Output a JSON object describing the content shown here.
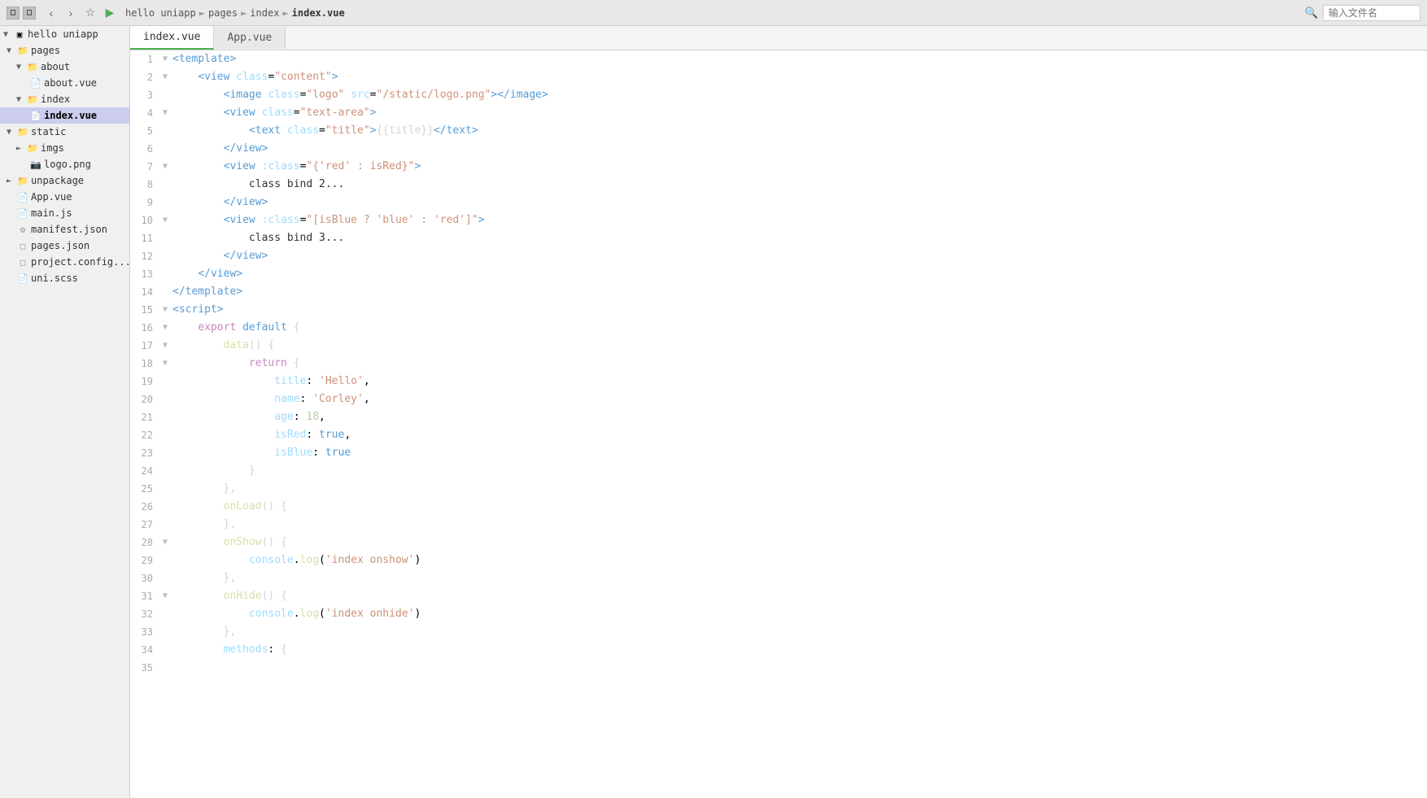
{
  "titleBar": {
    "breadcrumbs": [
      "hello uniapp",
      "pages",
      "index",
      "index.vue"
    ],
    "searchPlaceholder": "输入文件名"
  },
  "tabs": [
    {
      "label": "index.vue",
      "active": true
    },
    {
      "label": "App.vue",
      "active": false
    }
  ],
  "sidebar": {
    "root": "hello uniapp",
    "items": [
      {
        "level": 0,
        "type": "folder",
        "label": "pages",
        "expanded": true,
        "selected": false
      },
      {
        "level": 1,
        "type": "folder",
        "label": "about",
        "expanded": true,
        "selected": false
      },
      {
        "level": 2,
        "type": "file",
        "label": "about.vue",
        "selected": false
      },
      {
        "level": 1,
        "type": "folder",
        "label": "index",
        "expanded": true,
        "selected": false
      },
      {
        "level": 2,
        "type": "file",
        "label": "index.vue",
        "selected": true
      },
      {
        "level": 0,
        "type": "folder",
        "label": "static",
        "expanded": true,
        "selected": false
      },
      {
        "level": 1,
        "type": "folder",
        "label": "imgs",
        "expanded": false,
        "selected": false
      },
      {
        "level": 1,
        "type": "file",
        "label": "logo.png",
        "selected": false
      },
      {
        "level": 0,
        "type": "folder",
        "label": "unpackage",
        "expanded": false,
        "selected": false
      },
      {
        "level": 0,
        "type": "file",
        "label": "App.vue",
        "selected": false
      },
      {
        "level": 0,
        "type": "file",
        "label": "main.js",
        "selected": false
      },
      {
        "level": 0,
        "type": "file",
        "label": "manifest.json",
        "selected": false
      },
      {
        "level": 0,
        "type": "file",
        "label": "pages.json",
        "selected": false
      },
      {
        "level": 0,
        "type": "file",
        "label": "project.config...",
        "selected": false
      },
      {
        "level": 0,
        "type": "file",
        "label": "uni.scss",
        "selected": false
      }
    ]
  },
  "codeLines": [
    {
      "num": 1,
      "fold": true,
      "content": "<template>"
    },
    {
      "num": 2,
      "fold": true,
      "content": "    <view class=\"content\">"
    },
    {
      "num": 3,
      "fold": false,
      "content": "        <image class=\"logo\" src=\"/static/logo.png\"></image>"
    },
    {
      "num": 4,
      "fold": true,
      "content": "        <view class=\"text-area\">"
    },
    {
      "num": 5,
      "fold": false,
      "content": "            <text class=\"title\">{{title}}</text>"
    },
    {
      "num": 6,
      "fold": false,
      "content": "        </view>"
    },
    {
      "num": 7,
      "fold": true,
      "content": "        <view :class=\"{'red' : isRed}\">"
    },
    {
      "num": 8,
      "fold": false,
      "content": "            class bind 2..."
    },
    {
      "num": 9,
      "fold": false,
      "content": "        </view>"
    },
    {
      "num": 10,
      "fold": true,
      "content": "        <view :class=\"[isBlue ? 'blue' : 'red']\">"
    },
    {
      "num": 11,
      "fold": false,
      "content": "            class bind 3..."
    },
    {
      "num": 12,
      "fold": false,
      "content": "        </view>"
    },
    {
      "num": 13,
      "fold": false,
      "content": "    </view>"
    },
    {
      "num": 14,
      "fold": false,
      "content": "</template>"
    },
    {
      "num": 15,
      "fold": true,
      "content": "<script>"
    },
    {
      "num": 16,
      "fold": true,
      "content": "    export default {"
    },
    {
      "num": 17,
      "fold": true,
      "content": "        data() {"
    },
    {
      "num": 18,
      "fold": true,
      "content": "            return {"
    },
    {
      "num": 19,
      "fold": false,
      "content": "                title: 'Hello',"
    },
    {
      "num": 20,
      "fold": false,
      "content": "                name: 'Corley',"
    },
    {
      "num": 21,
      "fold": false,
      "content": "                age: 18,"
    },
    {
      "num": 22,
      "fold": false,
      "content": "                isRed: true,"
    },
    {
      "num": 23,
      "fold": false,
      "content": "                isBlue: true"
    },
    {
      "num": 24,
      "fold": false,
      "content": "            }"
    },
    {
      "num": 25,
      "fold": false,
      "content": "        },"
    },
    {
      "num": 26,
      "fold": false,
      "content": "        onLoad() {"
    },
    {
      "num": 27,
      "fold": false,
      "content": "        },"
    },
    {
      "num": 28,
      "fold": true,
      "content": "        onShow() {"
    },
    {
      "num": 29,
      "fold": false,
      "content": "            console.log('index onshow')"
    },
    {
      "num": 30,
      "fold": false,
      "content": "        },"
    },
    {
      "num": 31,
      "fold": true,
      "content": "        onHide() {"
    },
    {
      "num": 32,
      "fold": false,
      "content": "            console.log('index onhide')"
    },
    {
      "num": 33,
      "fold": false,
      "content": "        },"
    },
    {
      "num": 34,
      "fold": false,
      "content": "        methods: {"
    },
    {
      "num": 35,
      "fold": false,
      "content": ""
    }
  ]
}
